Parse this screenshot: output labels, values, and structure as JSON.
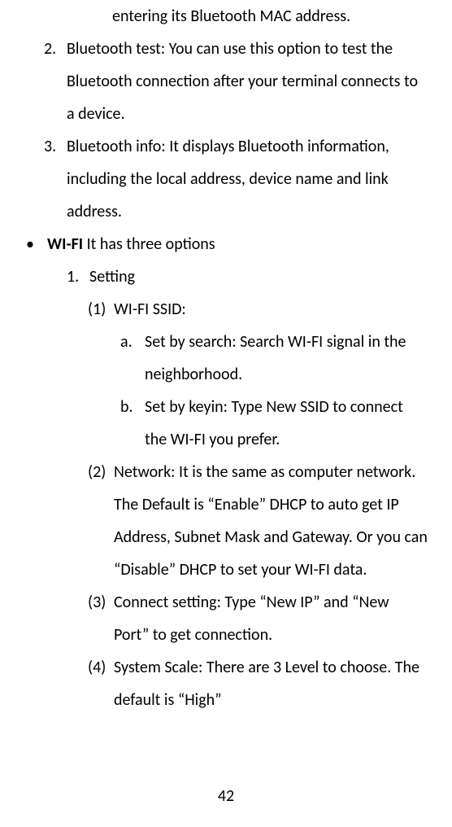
{
  "partial_top": "entering its Bluetooth MAC address.",
  "bluetooth_items": [
    {
      "marker": "2.",
      "text": "Bluetooth test: You can use this option to test the Bluetooth connection after your terminal connects to a device."
    },
    {
      "marker": "3.",
      "text": "Bluetooth info: It displays Bluetooth information, including the local address, device name and link address."
    }
  ],
  "wifi_bullet": {
    "dot": "•",
    "label": "WI-FI",
    "rest": " It has three options"
  },
  "wifi_setting_marker": "1.",
  "wifi_setting_label": "Setting",
  "wifi_ssid": {
    "marker": "(1)",
    "label": "WI-FI SSID:",
    "sub": [
      {
        "marker": "a.",
        "text": "Set by search: Search WI-FI signal in the neighborhood."
      },
      {
        "marker": "b.",
        "text": "Set by keyin: Type New SSID to connect the WI-FI you prefer."
      }
    ]
  },
  "wifi_network": {
    "marker": "(2)",
    "text": "Network: It is the same as computer network. The Default is “Enable” DHCP to auto get IP Address, Subnet Mask and Gateway. Or you can “Disable” DHCP to set your WI-FI data."
  },
  "wifi_connect": {
    "marker": "(3)",
    "text": "Connect setting: Type “New IP” and “New Port” to get connection."
  },
  "wifi_scale": {
    "marker": "(4)",
    "text": "System Scale: There are 3 Level to choose. The default is “High”"
  },
  "page_number": "42"
}
